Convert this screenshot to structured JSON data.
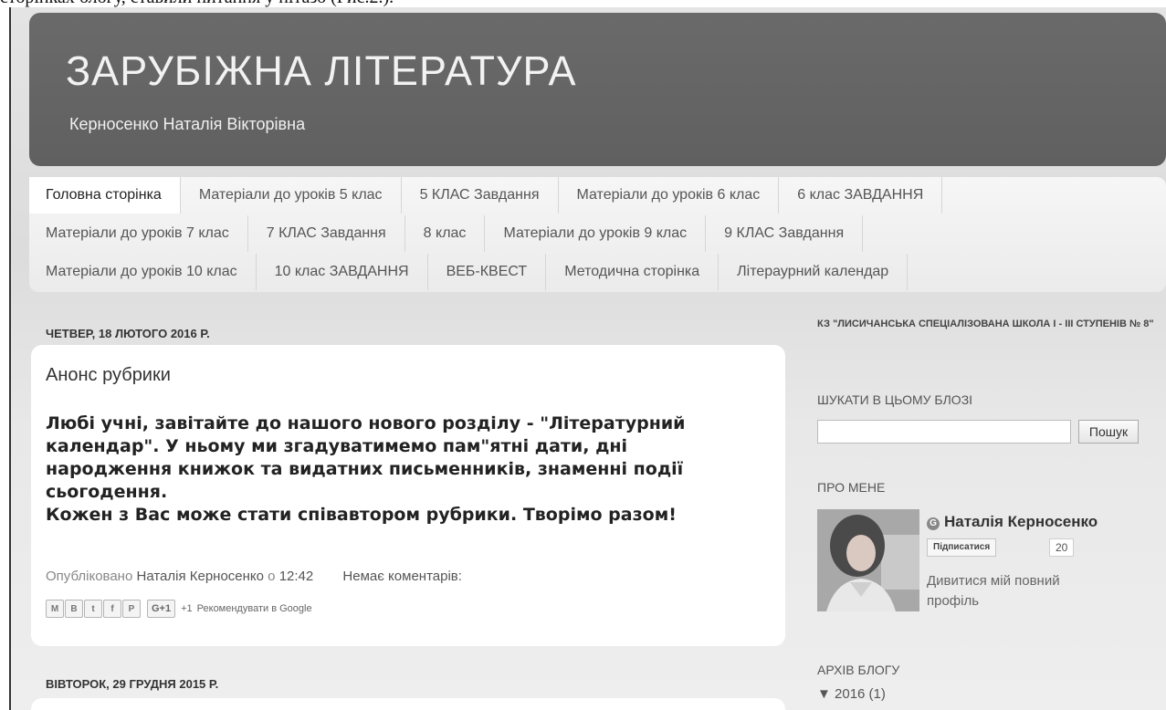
{
  "caption": "сторінках блогу, ставили питання у нітазо (Рис.2.).",
  "header": {
    "title": "ЗАРУБІЖНА ЛІТЕРАТУРА",
    "description": "Керносенко Наталія Вікторівна"
  },
  "nav": {
    "rows": [
      [
        "Головна сторінка",
        "Матеріали до уроків 5 клас",
        "5 КЛАС Завдання",
        "Матеріали до уроків 6 клас",
        "6 клас ЗАВДАННЯ"
      ],
      [
        "Матеріали до уроків 7 клас",
        "7 КЛАС Завдання",
        "8 клас",
        "Матеріали до уроків 9 клас",
        "9 КЛАС Завдання"
      ],
      [
        "Матеріали до уроків 10 клас",
        "10 клас ЗАВДАННЯ",
        "ВЕБ-КВЕСТ",
        "Методична сторінка",
        "Літераурний календар"
      ]
    ],
    "active": "Головна сторінка"
  },
  "posts": [
    {
      "date": "ЧЕТВЕР, 18 ЛЮТОГО 2016 Р.",
      "title": "Анонс рубрики",
      "body_lines": [
        "Любі учні, завітайте до нашого нового розділу - \"Літературний",
        "календар\". У ньому ми згадуватимемо пам\"ятні дати, дні",
        "народження книжок та видатних письменників, знаменні події",
        "сьогодення.",
        "Кожен з Вас може стати співавтором рубрики. Творімо разом!"
      ],
      "meta": {
        "published_label": "Опубліковано",
        "author": "Наталія Керносенко",
        "at_label": "о",
        "time": "12:42",
        "comments": "Немає коментарів:"
      },
      "share": {
        "buttons": [
          {
            "icon": "email-icon",
            "glyph": "M"
          },
          {
            "icon": "blogger-icon",
            "glyph": "B"
          },
          {
            "icon": "twitter-icon",
            "glyph": "t"
          },
          {
            "icon": "facebook-icon",
            "glyph": "f"
          },
          {
            "icon": "pinterest-icon",
            "glyph": "P"
          }
        ],
        "gplus_label": "G+1",
        "plus_count": "+1",
        "recommend": "Рекомендувати в Google"
      }
    },
    {
      "date": "ВІВТОРОК, 29 ГРУДНЯ 2015 Р."
    }
  ],
  "sidebar": {
    "school": "КЗ \"ЛИСИЧАНСЬКА СПЕЦІАЛІЗОВАНА ШКОЛА І - ІІІ СТУПЕНІВ № 8\"",
    "search": {
      "heading": "ШУКАТИ В ЦЬОМУ БЛОЗІ",
      "value": "",
      "button": "Пошук"
    },
    "about": {
      "heading": "ПРО МЕНЕ",
      "name": "Наталія Керносенко",
      "follow": "Підписатися",
      "follow_count": "20",
      "profile_link": "Дивитися мій повний профіль"
    },
    "archive": {
      "heading": "АРХІВ БЛОГУ",
      "item": "▼ 2016 (1)"
    }
  }
}
